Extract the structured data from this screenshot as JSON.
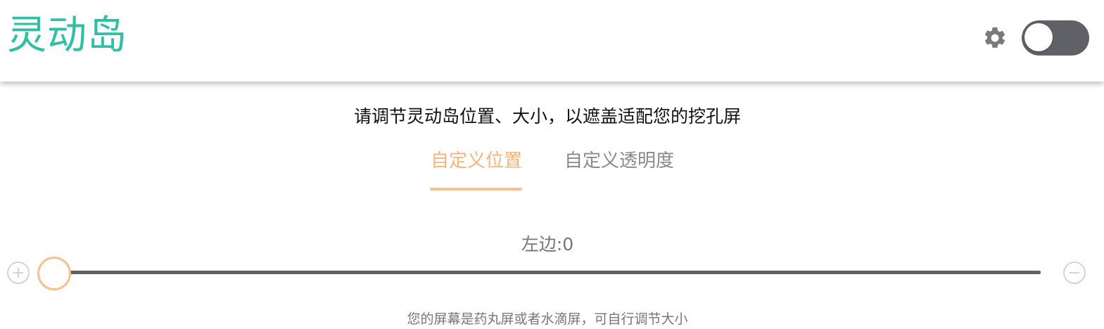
{
  "header": {
    "title": "灵动岛",
    "settings_icon": "gear-icon",
    "toggle": {
      "state": "off"
    }
  },
  "main": {
    "instruction": "请调节灵动岛位置、大小，以遮盖适配您的挖孔屏",
    "tabs": [
      {
        "label": "自定义位置",
        "active": true
      },
      {
        "label": "自定义透明度",
        "active": false
      }
    ],
    "slider": {
      "label": "左边:0",
      "value": 0,
      "increase_icon": "plus-circle-icon",
      "decrease_icon": "minus-circle-icon"
    },
    "hint": "您的屏幕是药丸屏或者水滴屏，可自行调节大小"
  },
  "colors": {
    "title": "#2fbfa5",
    "accent": "#f6b580",
    "track": "#5f6166",
    "toggle_bg": "#5f6166"
  }
}
